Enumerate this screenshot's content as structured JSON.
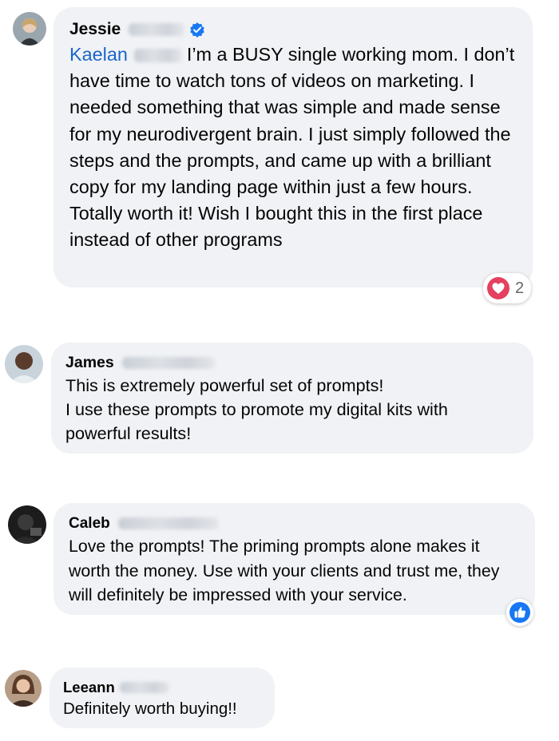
{
  "comments": [
    {
      "author_first": "Jessie",
      "verified": true,
      "mention": "Kaelan",
      "text": "I’m a BUSY single working mom. I don’t have time to watch tons of videos on marketing. I needed something that was simple and made sense for my neurodivergent brain. I just simply followed the steps and the prompts, and came up with a brilliant copy for my landing page within just a few hours. Totally worth it! Wish I bought this in the first place instead of other programs",
      "reaction": {
        "icon": "heart-icon",
        "count": "2"
      }
    },
    {
      "author_first": "James",
      "lines": [
        "This is extremely powerful set of prompts!",
        "I use these prompts to promote my digital kits with powerful results!"
      ]
    },
    {
      "author_first": "Caleb",
      "text": "Love the prompts! The priming prompts alone makes it worth the money. Use with your clients and trust me, they will definitely be impressed with your service.",
      "reaction": {
        "icon": "like-icon"
      }
    },
    {
      "author_first": "Leeann",
      "text": "Definitely worth buying!!"
    }
  ],
  "colors": {
    "bubble": "#f0f2f5",
    "mention": "#1a66c8",
    "verified": "#1877f2",
    "heart": "#e4405f",
    "like": "#1877f2"
  }
}
